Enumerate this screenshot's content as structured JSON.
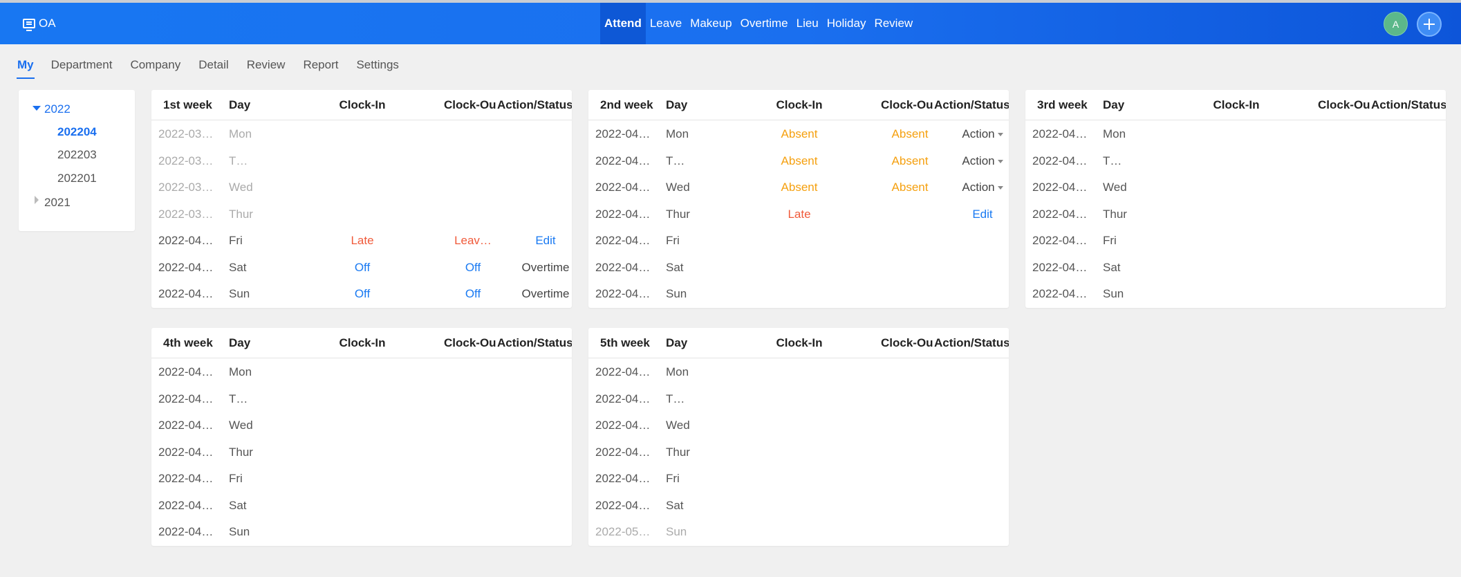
{
  "app": {
    "logo_text": "OA"
  },
  "header": {
    "nav": [
      "Attend",
      "Leave",
      "Makeup",
      "Overtime",
      "Lieu",
      "Holiday",
      "Review"
    ],
    "active_nav": "Attend",
    "avatar_letter": "A"
  },
  "sub_nav": {
    "items": [
      "My",
      "Department",
      "Company",
      "Detail",
      "Review",
      "Report",
      "Settings"
    ],
    "active": "My"
  },
  "tree": {
    "years": [
      {
        "label": "2022",
        "expanded": true,
        "months": [
          "202204",
          "202203",
          "202201"
        ],
        "selected": "202204"
      },
      {
        "label": "2021",
        "expanded": false,
        "months": []
      }
    ]
  },
  "columns": {
    "day": "Day",
    "clock_in": "Clock-In",
    "clock_out": "Clock-Ou",
    "action": "Action/Status"
  },
  "weeks": [
    {
      "title": "1st week",
      "rows": [
        {
          "date": "2022-03…",
          "day": "Mon",
          "muted": true
        },
        {
          "date": "2022-03…",
          "day": "T…",
          "muted": true
        },
        {
          "date": "2022-03…",
          "day": "Wed",
          "muted": true
        },
        {
          "date": "2022-03…",
          "day": "Thur",
          "muted": true
        },
        {
          "date": "2022-04…",
          "day": "Fri",
          "clock_in": "Late",
          "clock_in_color": "red",
          "clock_out": "Leav…",
          "clock_out_color": "red",
          "action": "Edit",
          "action_color": "blue"
        },
        {
          "date": "2022-04…",
          "day": "Sat",
          "clock_in": "Off",
          "clock_in_color": "blue",
          "clock_out": "Off",
          "clock_out_color": "blue",
          "action": "Overtime",
          "action_color": "dark"
        },
        {
          "date": "2022-04…",
          "day": "Sun",
          "clock_in": "Off",
          "clock_in_color": "blue",
          "clock_out": "Off",
          "clock_out_color": "blue",
          "action": "Overtime",
          "action_color": "dark"
        }
      ]
    },
    {
      "title": "2nd week",
      "rows": [
        {
          "date": "2022-04…",
          "day": "Mon",
          "clock_in": "Absent",
          "clock_in_color": "orange",
          "clock_out": "Absent",
          "clock_out_color": "orange",
          "action": "Action",
          "action_color": "dark",
          "dropdown": true
        },
        {
          "date": "2022-04…",
          "day": "T…",
          "clock_in": "Absent",
          "clock_in_color": "orange",
          "clock_out": "Absent",
          "clock_out_color": "orange",
          "action": "Action",
          "action_color": "dark",
          "dropdown": true
        },
        {
          "date": "2022-04…",
          "day": "Wed",
          "clock_in": "Absent",
          "clock_in_color": "orange",
          "clock_out": "Absent",
          "clock_out_color": "orange",
          "action": "Action",
          "action_color": "dark",
          "dropdown": true
        },
        {
          "date": "2022-04…",
          "day": "Thur",
          "clock_in": "Late",
          "clock_in_color": "red",
          "action": "Edit",
          "action_color": "blue"
        },
        {
          "date": "2022-04…",
          "day": "Fri"
        },
        {
          "date": "2022-04…",
          "day": "Sat"
        },
        {
          "date": "2022-04…",
          "day": "Sun"
        }
      ]
    },
    {
      "title": "3rd week",
      "rows": [
        {
          "date": "2022-04…",
          "day": "Mon"
        },
        {
          "date": "2022-04…",
          "day": "T…"
        },
        {
          "date": "2022-04…",
          "day": "Wed"
        },
        {
          "date": "2022-04…",
          "day": "Thur"
        },
        {
          "date": "2022-04…",
          "day": "Fri"
        },
        {
          "date": "2022-04…",
          "day": "Sat"
        },
        {
          "date": "2022-04…",
          "day": "Sun"
        }
      ]
    },
    {
      "title": "4th week",
      "rows": [
        {
          "date": "2022-04…",
          "day": "Mon"
        },
        {
          "date": "2022-04…",
          "day": "T…"
        },
        {
          "date": "2022-04…",
          "day": "Wed"
        },
        {
          "date": "2022-04…",
          "day": "Thur"
        },
        {
          "date": "2022-04…",
          "day": "Fri"
        },
        {
          "date": "2022-04…",
          "day": "Sat"
        },
        {
          "date": "2022-04…",
          "day": "Sun"
        }
      ]
    },
    {
      "title": "5th week",
      "rows": [
        {
          "date": "2022-04…",
          "day": "Mon"
        },
        {
          "date": "2022-04…",
          "day": "T…"
        },
        {
          "date": "2022-04…",
          "day": "Wed"
        },
        {
          "date": "2022-04…",
          "day": "Thur"
        },
        {
          "date": "2022-04…",
          "day": "Fri"
        },
        {
          "date": "2022-04…",
          "day": "Sat"
        },
        {
          "date": "2022-05…",
          "day": "Sun",
          "muted": true
        }
      ]
    }
  ],
  "colors": {
    "primary": "#1a6fef",
    "late": "#f05a3a",
    "absent": "#f5a00f",
    "off": "#1a7af2"
  }
}
